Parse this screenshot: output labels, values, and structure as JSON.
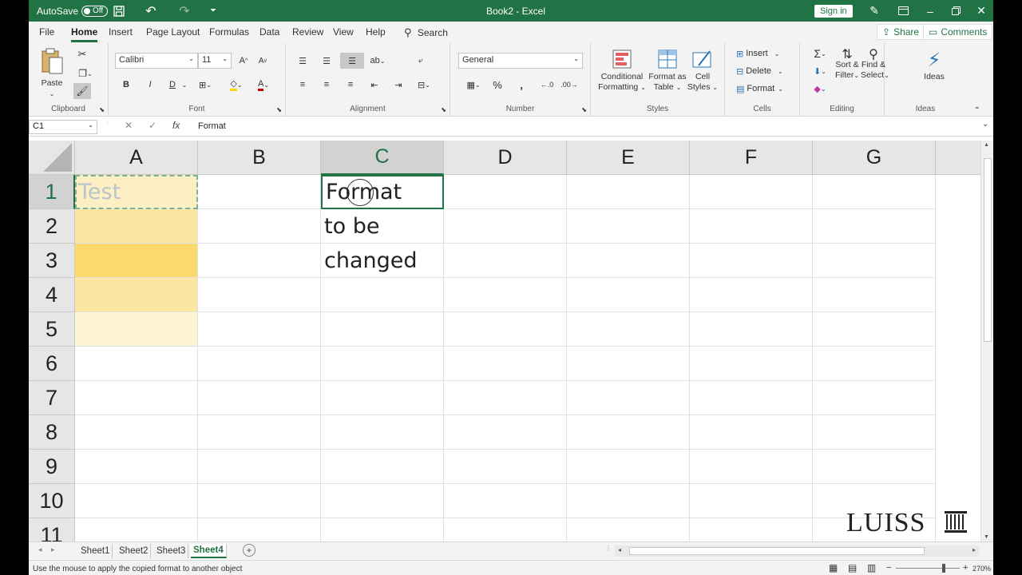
{
  "titlebar": {
    "autosave_label": "AutoSave",
    "autosave_state": "Off",
    "doc_title": "Book2 - Excel",
    "signin_label": "Sign in"
  },
  "menu": {
    "tabs": [
      "File",
      "Home",
      "Insert",
      "Page Layout",
      "Formulas",
      "Data",
      "Review",
      "View",
      "Help"
    ],
    "active_tab": "Home",
    "search_label": "Search",
    "share_label": "Share",
    "comments_label": "Comments"
  },
  "ribbon": {
    "clipboard": {
      "label": "Clipboard",
      "paste": "Paste"
    },
    "font": {
      "label": "Font",
      "font_name": "Calibri",
      "font_size": "11",
      "bold": "B",
      "italic": "I",
      "underline": "D"
    },
    "alignment": {
      "label": "Alignment"
    },
    "number": {
      "label": "Number",
      "format": "General"
    },
    "styles": {
      "label": "Styles",
      "conditional_line1": "Conditional",
      "conditional_line2": "Formatting",
      "format_table_line1": "Format as",
      "format_table_line2": "Table",
      "cell_styles_line1": "Cell",
      "cell_styles_line2": "Styles"
    },
    "cells": {
      "label": "Cells",
      "insert": "Insert",
      "delete": "Delete",
      "format": "Format"
    },
    "editing": {
      "label": "Editing",
      "sort_line1": "Sort &",
      "sort_line2": "Filter",
      "find_line1": "Find &",
      "find_line2": "Select"
    },
    "ideas": {
      "label": "Ideas",
      "button": "Ideas"
    }
  },
  "formula_bar": {
    "name_box": "C1",
    "cancel": "✕",
    "enter": "✓",
    "fx": "fx",
    "value": "Format"
  },
  "grid": {
    "columns": [
      "A",
      "B",
      "C",
      "D",
      "E",
      "F",
      "G"
    ],
    "selected_column": "C",
    "rows": [
      "1",
      "2",
      "3",
      "4",
      "5",
      "6",
      "7",
      "8",
      "9",
      "10",
      "11"
    ],
    "selected_row": "1",
    "cells": {
      "A1": "Test",
      "C1": "Format",
      "C2": "to be",
      "C3": "changed"
    },
    "fill_colors": {
      "A1": "#fbefc3",
      "A2": "#fbe6a2",
      "A3": "#fbd96d",
      "A4": "#fbe6a2",
      "A5": "#fdf3d3"
    }
  },
  "sheets": {
    "tabs": [
      "Sheet1",
      "Sheet2",
      "Sheet3",
      "Sheet4"
    ],
    "active": "Sheet4"
  },
  "status": {
    "message": "Use the mouse to apply the copied format to another object",
    "zoom": "270%"
  },
  "watermark": {
    "text": "LUISS"
  },
  "colors": {
    "accent": "#217346"
  }
}
